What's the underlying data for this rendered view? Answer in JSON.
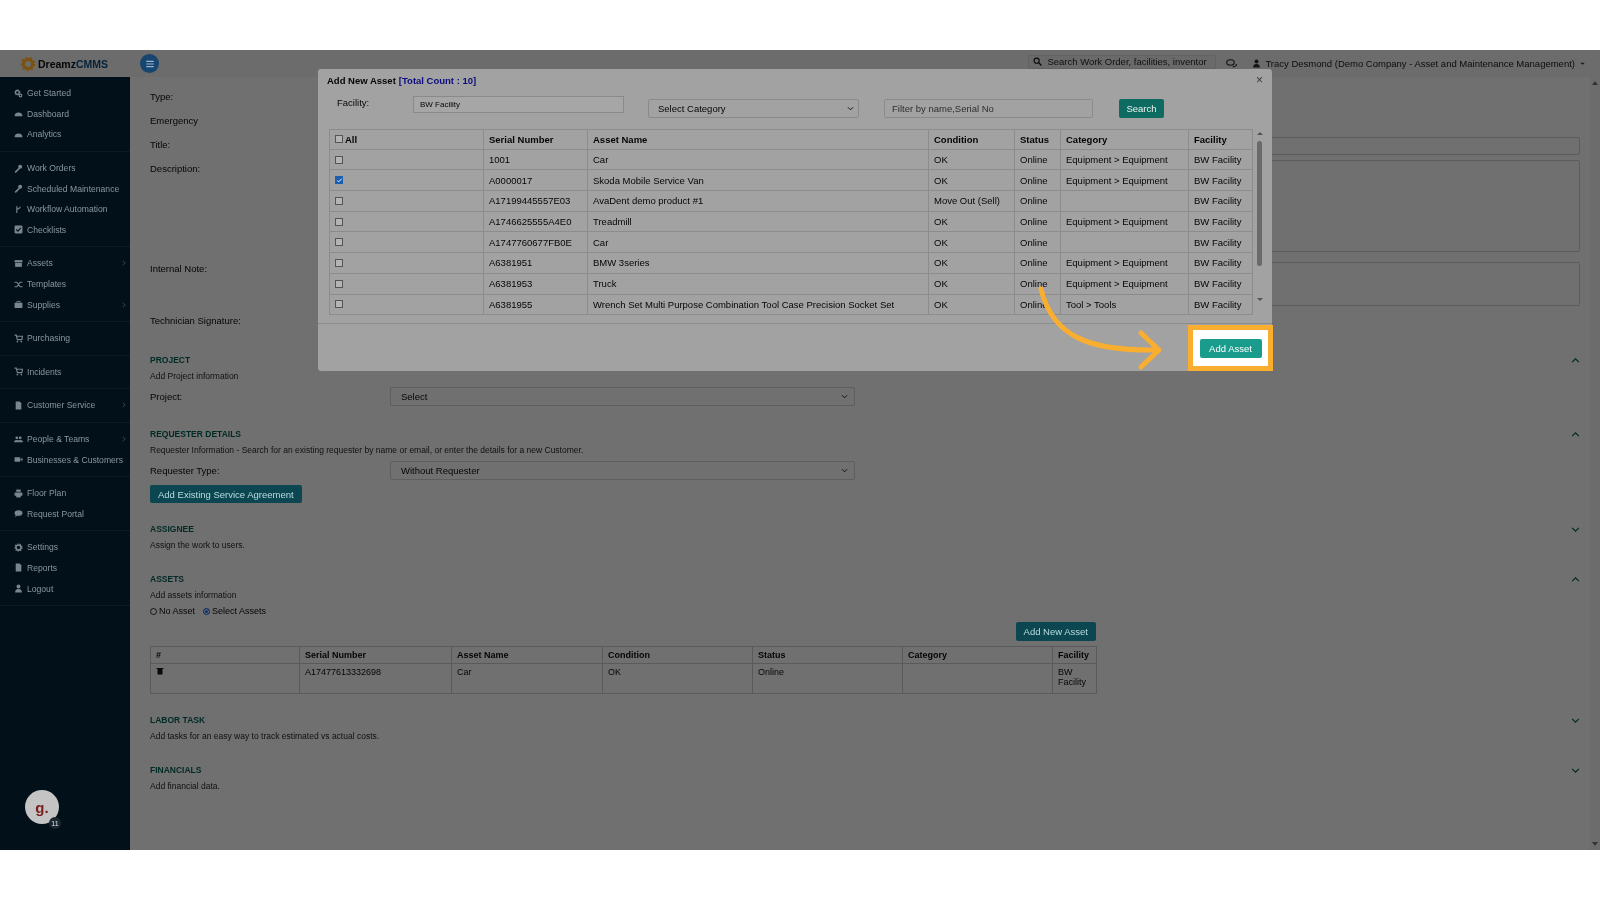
{
  "topbar": {
    "logo": {
      "prefix": "Dreamz",
      "suffix": "CMMS"
    },
    "search": {
      "placeholder": "Search Work Order, facilities, inventor"
    },
    "user": "Tracy Desmond (Demo Company - Asset and Maintenance Management)"
  },
  "sidebar": {
    "groups": [
      [
        {
          "label": "Get Started",
          "submenu": false
        },
        {
          "label": "Dashboard",
          "submenu": false
        },
        {
          "label": "Analytics",
          "submenu": false
        }
      ],
      [
        {
          "label": "Work Orders",
          "submenu": false
        },
        {
          "label": "Scheduled Maintenance",
          "submenu": false
        },
        {
          "label": "Workflow Automation",
          "submenu": false
        },
        {
          "label": "Checklists",
          "submenu": false
        }
      ],
      [
        {
          "label": "Assets",
          "submenu": true
        },
        {
          "label": "Templates",
          "submenu": false
        },
        {
          "label": "Supplies",
          "submenu": true
        }
      ],
      [
        {
          "label": "Purchasing",
          "submenu": false
        }
      ],
      [
        {
          "label": "Incidents",
          "submenu": false
        }
      ],
      [
        {
          "label": "Customer Service",
          "submenu": true
        }
      ],
      [
        {
          "label": "People & Teams",
          "submenu": true
        },
        {
          "label": "Businesses & Customers",
          "submenu": false
        }
      ],
      [
        {
          "label": "Floor Plan",
          "submenu": false
        },
        {
          "label": "Request Portal",
          "submenu": false
        }
      ],
      [
        {
          "label": "Settings",
          "submenu": false
        },
        {
          "label": "Reports",
          "submenu": false
        },
        {
          "label": "Logout",
          "submenu": false
        }
      ]
    ],
    "avatar": {
      "letter": "g.",
      "badge": "11"
    }
  },
  "form": {
    "fields": [
      {
        "label": "Type:",
        "kind": "none"
      },
      {
        "label": "Emergency",
        "kind": "none"
      },
      {
        "label": "Title:",
        "kind": "input"
      },
      {
        "label": "Description:",
        "kind": "textarea"
      },
      {
        "label": "Internal Note:",
        "kind": "note"
      },
      {
        "label": "Technician Signature:",
        "kind": "none"
      }
    ],
    "sections": [
      {
        "title": "PROJECT",
        "subtitle": "Add Project information",
        "expanded": true,
        "select": {
          "label": "Project:",
          "value": "Select"
        }
      },
      {
        "title": "REQUESTER DETAILS",
        "subtitle": "Requester Information - Search for an existing requester by name or email, or enter the details for a new Customer.",
        "expanded": true,
        "select": {
          "label": "Requester Type:",
          "value": "Without Requester"
        },
        "button": "Add Existing Service Agreement"
      },
      {
        "title": "ASSIGNEE",
        "subtitle": "Assign the work to users.",
        "expanded": false
      },
      {
        "title": "ASSETS",
        "subtitle": "Add assets information",
        "expanded": true,
        "options": [
          {
            "label": "No Asset",
            "selected": false
          },
          {
            "label": "Select Assets",
            "selected": true
          }
        ],
        "button": "Add New Asset",
        "table": {
          "columns": [
            "#",
            "Serial Number",
            "Asset Name",
            "Condition",
            "Status",
            "Category",
            "Facility"
          ],
          "rows": [
            {
              "cells": [
                null,
                "A17477613332698",
                "Car",
                "OK",
                "Online",
                null,
                "BW Facility"
              ]
            }
          ]
        }
      },
      {
        "title": "LABOR TASK",
        "subtitle": "Add tasks for an easy way to track estimated vs actual costs.",
        "expanded": false
      },
      {
        "title": "FINANCIALS",
        "subtitle": "Add financial data.",
        "expanded": false
      }
    ]
  },
  "modal": {
    "title": "Add New Asset",
    "count": "[Total Count : 10]",
    "close": "×",
    "facility": {
      "label": "Facility:",
      "value": "BW Facility"
    },
    "category": {
      "value": "Select Category"
    },
    "filter": {
      "placeholder": "Filter by name,Serial No"
    },
    "search_button": "Search",
    "select_all": {
      "label": "All",
      "checked": false
    },
    "columns": [
      "Serial Number",
      "Asset Name",
      "Condition",
      "Status",
      "Category",
      "Facility"
    ],
    "rows": [
      {
        "selected": false,
        "cells": [
          "1001",
          "Car",
          "OK",
          "Online",
          "Equipment > Equipment",
          "BW Facility"
        ]
      },
      {
        "selected": true,
        "cells": [
          "A0000017",
          "Skoda Mobile Service Van",
          "OK",
          "Online",
          "Equipment > Equipment",
          "BW Facility"
        ]
      },
      {
        "selected": false,
        "cells": [
          "A17199445557E03",
          "AvaDent demo product #1",
          "Move Out (Sell)",
          "Online",
          null,
          "BW Facility"
        ]
      },
      {
        "selected": false,
        "cells": [
          "A1746625555A4E0",
          "Treadmill",
          "OK",
          "Online",
          "Equipment > Equipment",
          "BW Facility"
        ]
      },
      {
        "selected": false,
        "cells": [
          "A1747760677FB0E",
          "Car",
          "OK",
          "Online",
          null,
          "BW Facility"
        ]
      },
      {
        "selected": false,
        "cells": [
          "A6381951",
          "BMW 3series",
          "OK",
          "Online",
          "Equipment > Equipment",
          "BW Facility"
        ]
      },
      {
        "selected": false,
        "cells": [
          "A6381953",
          "Truck",
          "OK",
          "Online",
          "Equipment > Equipment",
          "BW Facility"
        ]
      },
      {
        "selected": false,
        "cells": [
          "A6381955",
          "Wrench Set Multi Purpose Combination Tool Case Precision Socket Set",
          "OK",
          "Online",
          "Tool > Tools",
          "BW Facility"
        ]
      }
    ],
    "add_button": "Add Asset"
  }
}
